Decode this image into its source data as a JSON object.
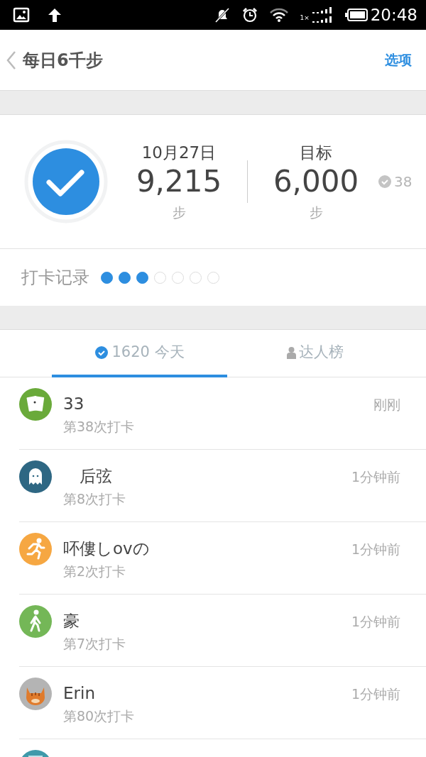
{
  "status_bar": {
    "network_label": "1×",
    "time": "20:48"
  },
  "header": {
    "title": "每日6千步",
    "action": "选项"
  },
  "summary": {
    "checked": true,
    "date": "10月27日",
    "steps": "9,215",
    "steps_unit": "步",
    "goal_label": "目标",
    "goal": "6,000",
    "goal_unit": "步",
    "badge_count": "38"
  },
  "record": {
    "label": "打卡记录",
    "days": [
      {
        "checked": true
      },
      {
        "checked": true
      },
      {
        "checked": true
      },
      {
        "checked": false
      },
      {
        "checked": false
      },
      {
        "checked": false
      },
      {
        "checked": false
      }
    ]
  },
  "tabs": [
    {
      "label": "1620 今天",
      "kind": "check",
      "selected": true
    },
    {
      "label": "达人榜",
      "kind": "person",
      "selected": false
    }
  ],
  "entries": [
    {
      "kind": "cards",
      "color": "#6aaa3a",
      "name": "33",
      "count": "第38次打卡",
      "time": "刚刚"
    },
    {
      "kind": "ghost",
      "color": "#2e6783",
      "name": "　后弦",
      "count": "第8次打卡",
      "time": "1分钟前"
    },
    {
      "kind": "runner",
      "color": "#f6a742",
      "name": "吥僂しovの",
      "count": "第2次打卡",
      "time": "1分钟前"
    },
    {
      "kind": "walker",
      "color": "#74b757",
      "name": "豪",
      "count": "第7次打卡",
      "time": "1分钟前"
    },
    {
      "kind": "cat",
      "color": "#b4b4b4",
      "name": "Erin",
      "count": "第80次打卡",
      "time": "1分钟前"
    },
    {
      "kind": "picture",
      "color": "#3f9aaa"
    }
  ]
}
